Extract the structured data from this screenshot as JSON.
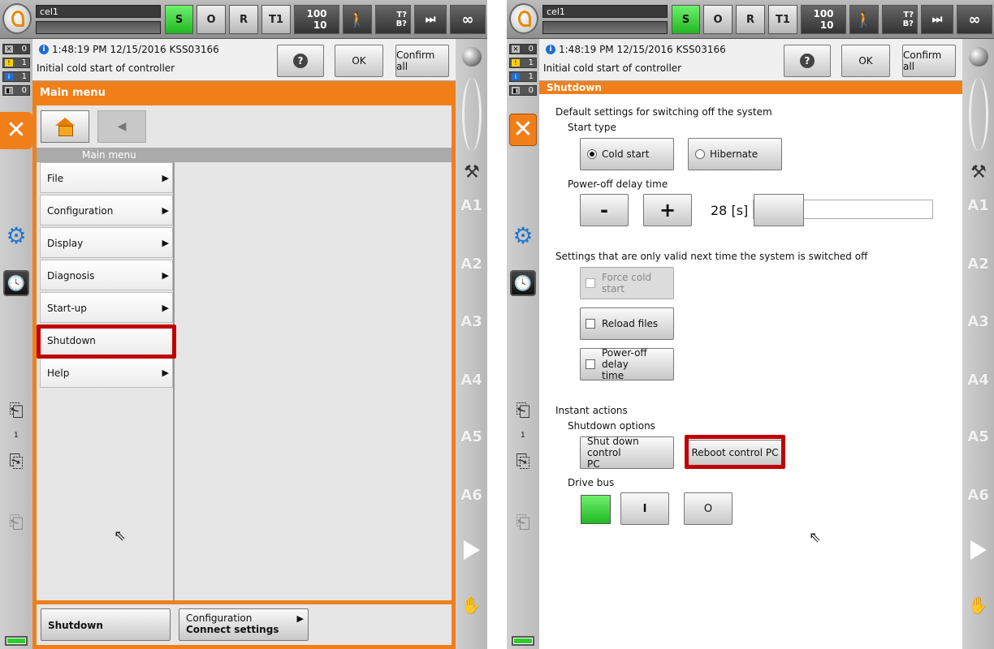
{
  "status": {
    "cell": "cel1",
    "mode_s": "S",
    "mode_o": "O",
    "mode_r": "R",
    "mode_t1": "T1",
    "override_prog": "100",
    "override_jog": "10",
    "tool": "T?",
    "base": "B?",
    "infinity": "∞"
  },
  "counters": [
    "0",
    "1",
    "1",
    "0"
  ],
  "side_count": "1",
  "message": {
    "time": "1:48:19 PM 12/15/2016 KSS03166",
    "text": "Initial cold start of controller",
    "help_label": "?",
    "ok_label": "OK",
    "confirm_all_label": "Confirm all"
  },
  "axes": [
    "A1",
    "A2",
    "A3",
    "A4",
    "A5",
    "A6"
  ],
  "main_menu": {
    "title": "Main menu",
    "column_header": "Main menu",
    "items": [
      {
        "label": "File",
        "arrow": "▶"
      },
      {
        "label": "Configuration",
        "arrow": "▶"
      },
      {
        "label": "Display",
        "arrow": "▶"
      },
      {
        "label": "Diagnosis",
        "arrow": "▶"
      },
      {
        "label": "Start-up",
        "arrow": "▶"
      },
      {
        "label": "Shutdown",
        "arrow": ""
      },
      {
        "label": "Help",
        "arrow": "▶"
      }
    ],
    "bottom": {
      "shutdown_label": "Shutdown",
      "config_line1": "Configuration",
      "config_line2": "Connect settings",
      "config_arrow": "▶"
    }
  },
  "shutdown": {
    "title": "Shutdown",
    "default_header": "Default settings for switching off the system",
    "start_type_label": "Start type",
    "cold_start": "Cold start",
    "hibernate": "Hibernate",
    "delay_label": "Power-off delay time",
    "minus": "-",
    "plus": "+",
    "delay_value": "28 [s]",
    "delay_fraction": 0.28,
    "next_time_header": "Settings that are only valid next time the system is switched off",
    "force_cold": "Force cold start",
    "reload_files": "Reload files",
    "power_off_delay_l1": "Power-off delay",
    "power_off_delay_l2": "time",
    "instant_header": "Instant actions",
    "shutdown_options_label": "Shutdown options",
    "shut_down_l1": "Shut down control",
    "shut_down_l2": "PC",
    "reboot": "Reboot control PC",
    "drive_bus_label": "Drive bus",
    "drive_on": "I",
    "drive_off": "O"
  },
  "colors": {
    "accent": "#f07f1a",
    "highlight": "#c00000",
    "ok_green": "#2ecc2e"
  }
}
